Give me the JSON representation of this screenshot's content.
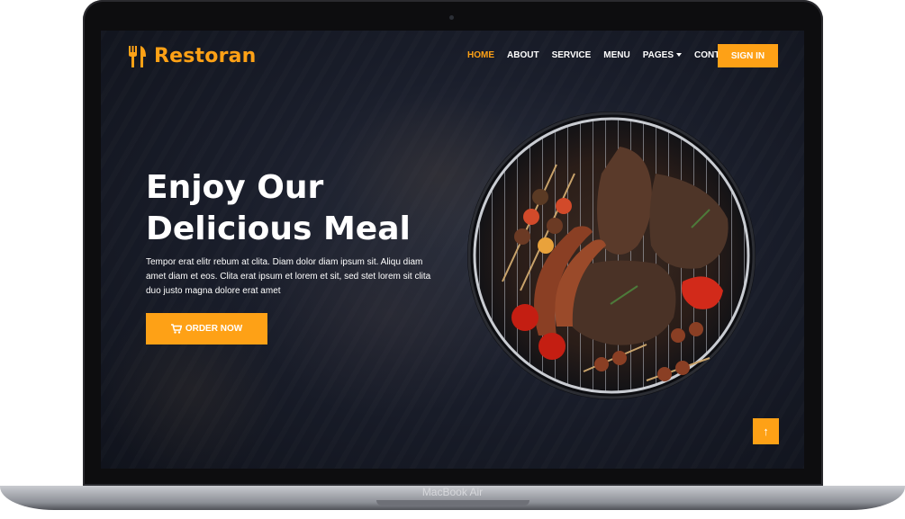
{
  "device": {
    "label": "MacBook Air"
  },
  "brand": {
    "name": "Restoran",
    "icon": "utensils-icon"
  },
  "nav": {
    "items": [
      {
        "label": "HOME",
        "active": true
      },
      {
        "label": "ABOUT",
        "active": false
      },
      {
        "label": "SERVICE",
        "active": false
      },
      {
        "label": "MENU",
        "active": false
      },
      {
        "label": "PAGES",
        "active": false,
        "dropdown": true
      },
      {
        "label": "CONTACT",
        "active": false
      }
    ],
    "signin_label": "SIGN IN"
  },
  "hero": {
    "title_line1": "Enjoy Our",
    "title_line2": "Delicious Meal",
    "description": "Tempor erat elitr rebum at clita. Diam dolor diam ipsum sit. Aliqu diam amet diam et eos. Clita erat ipsum et lorem et sit, sed stet lorem sit clita duo justo magna dolore erat amet",
    "order_label": "ORDER NOW",
    "order_icon": "cart-icon",
    "image": "bbq-grill-image"
  },
  "back_to_top": {
    "icon": "arrow-up-icon",
    "glyph": "↑"
  },
  "colors": {
    "accent": "#fea116",
    "background": "#1a1e2b",
    "text": "#ffffff"
  }
}
